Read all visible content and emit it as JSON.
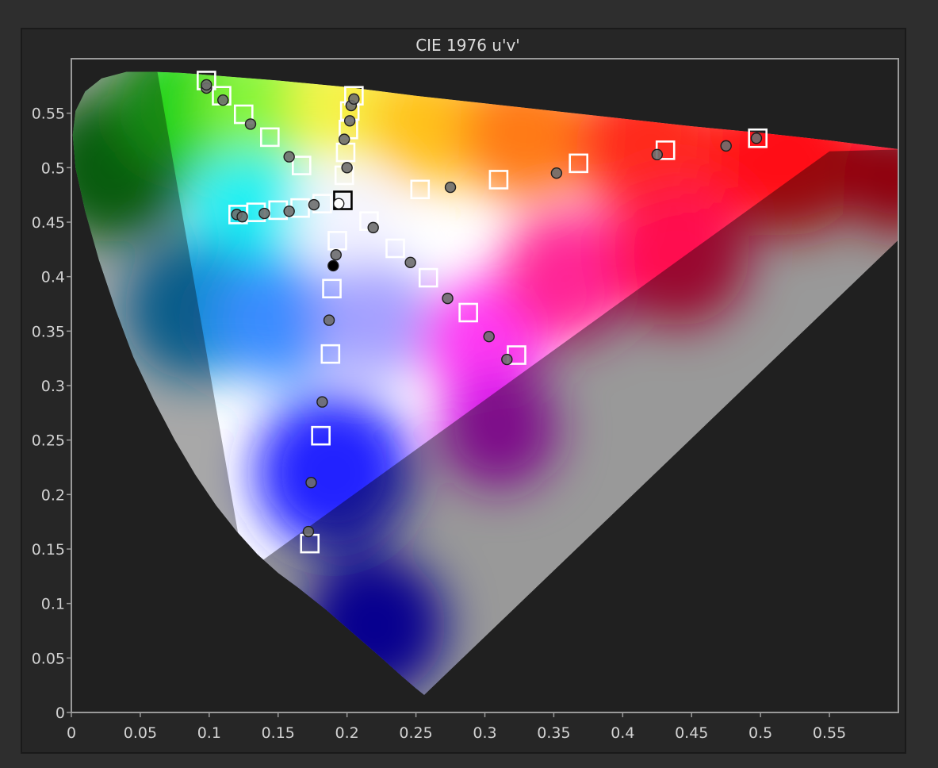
{
  "chart_data": {
    "type": "scatter",
    "title": "CIE 1976 u'v'",
    "xlabel": "",
    "ylabel": "",
    "xlim": [
      0,
      0.6
    ],
    "ylim": [
      0,
      0.6
    ],
    "x_ticks": [
      "0",
      "0.05",
      "0.1",
      "0.15",
      "0.2",
      "0.25",
      "0.3",
      "0.35",
      "0.4",
      "0.45",
      "0.5",
      "0.55"
    ],
    "y_ticks": [
      "0",
      "0.05",
      "0.1",
      "0.15",
      "0.2",
      "0.25",
      "0.3",
      "0.35",
      "0.4",
      "0.45",
      "0.5",
      "0.55"
    ],
    "grid": false,
    "background_region": "CIE 1976 u'v' spectral locus (horseshoe) filled with chromaticity colors",
    "series": [
      {
        "marker": "square",
        "edge_color": "#ffffff",
        "points": [
          {
            "x": 0.098,
            "y": 0.58
          },
          {
            "x": 0.109,
            "y": 0.566
          },
          {
            "x": 0.125,
            "y": 0.549
          },
          {
            "x": 0.144,
            "y": 0.528
          },
          {
            "x": 0.167,
            "y": 0.502
          },
          {
            "x": 0.198,
            "y": 0.493
          },
          {
            "x": 0.199,
            "y": 0.514
          },
          {
            "x": 0.201,
            "y": 0.535
          },
          {
            "x": 0.202,
            "y": 0.552
          },
          {
            "x": 0.205,
            "y": 0.566
          },
          {
            "x": 0.253,
            "y": 0.48
          },
          {
            "x": 0.31,
            "y": 0.489
          },
          {
            "x": 0.368,
            "y": 0.504
          },
          {
            "x": 0.431,
            "y": 0.516
          },
          {
            "x": 0.498,
            "y": 0.527
          },
          {
            "x": 0.121,
            "y": 0.457
          },
          {
            "x": 0.134,
            "y": 0.459
          },
          {
            "x": 0.15,
            "y": 0.461
          },
          {
            "x": 0.166,
            "y": 0.463
          },
          {
            "x": 0.182,
            "y": 0.467
          },
          {
            "x": 0.216,
            "y": 0.451
          },
          {
            "x": 0.235,
            "y": 0.426
          },
          {
            "x": 0.259,
            "y": 0.399
          },
          {
            "x": 0.288,
            "y": 0.367
          },
          {
            "x": 0.323,
            "y": 0.328
          },
          {
            "x": 0.193,
            "y": 0.433
          },
          {
            "x": 0.189,
            "y": 0.389
          },
          {
            "x": 0.188,
            "y": 0.329
          },
          {
            "x": 0.181,
            "y": 0.254
          },
          {
            "x": 0.173,
            "y": 0.155
          },
          {
            "x": 0.197,
            "y": 0.47,
            "edge_color": "#000000"
          }
        ]
      },
      {
        "marker": "circle",
        "face_color": "#6e6e6e",
        "edge_color": "#1e1e1e",
        "points": [
          {
            "x": 0.098,
            "y": 0.573
          },
          {
            "x": 0.098,
            "y": 0.576
          },
          {
            "x": 0.11,
            "y": 0.562
          },
          {
            "x": 0.13,
            "y": 0.54
          },
          {
            "x": 0.158,
            "y": 0.51
          },
          {
            "x": 0.2,
            "y": 0.5
          },
          {
            "x": 0.198,
            "y": 0.526
          },
          {
            "x": 0.202,
            "y": 0.543
          },
          {
            "x": 0.203,
            "y": 0.557
          },
          {
            "x": 0.205,
            "y": 0.563
          },
          {
            "x": 0.275,
            "y": 0.482
          },
          {
            "x": 0.352,
            "y": 0.495
          },
          {
            "x": 0.425,
            "y": 0.512
          },
          {
            "x": 0.475,
            "y": 0.52
          },
          {
            "x": 0.497,
            "y": 0.527
          },
          {
            "x": 0.12,
            "y": 0.457
          },
          {
            "x": 0.124,
            "y": 0.455
          },
          {
            "x": 0.14,
            "y": 0.458
          },
          {
            "x": 0.158,
            "y": 0.46
          },
          {
            "x": 0.176,
            "y": 0.466
          },
          {
            "x": 0.219,
            "y": 0.445
          },
          {
            "x": 0.246,
            "y": 0.413
          },
          {
            "x": 0.273,
            "y": 0.38
          },
          {
            "x": 0.303,
            "y": 0.345
          },
          {
            "x": 0.316,
            "y": 0.324
          },
          {
            "x": 0.192,
            "y": 0.42
          },
          {
            "x": 0.187,
            "y": 0.36
          },
          {
            "x": 0.182,
            "y": 0.285
          },
          {
            "x": 0.174,
            "y": 0.211
          },
          {
            "x": 0.172,
            "y": 0.166
          },
          {
            "x": 0.19,
            "y": 0.41,
            "face_color": "#000000"
          },
          {
            "x": 0.194,
            "y": 0.467,
            "face_color": "#ffffff"
          }
        ]
      }
    ]
  }
}
